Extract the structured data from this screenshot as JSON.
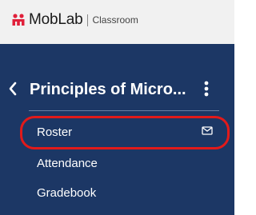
{
  "header": {
    "brand": "MobLab",
    "product": "Classroom",
    "logo_icon": "moblab-logo-icon",
    "logo_color": "#e0203a"
  },
  "sidebar": {
    "background": "#1c3765",
    "course_title": "Principles of Micro...",
    "back_icon": "chevron-left-icon",
    "menu_icon": "kebab-menu-icon",
    "items": [
      {
        "label": "Roster",
        "icon": "mail-icon"
      },
      {
        "label": "Attendance"
      },
      {
        "label": "Gradebook"
      }
    ]
  },
  "annotation": {
    "highlight_color": "#e21a1a"
  }
}
